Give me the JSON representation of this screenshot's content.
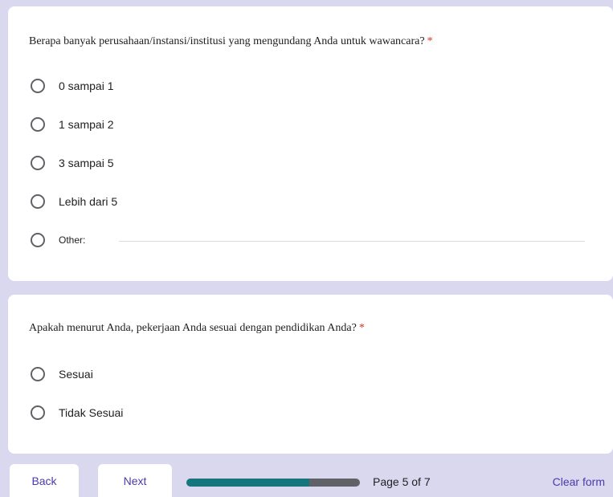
{
  "questions": [
    {
      "text": "Berapa banyak perusahaan/instansi/institusi yang mengundang Anda untuk wawancara?",
      "required_mark": "*",
      "options": [
        "0 sampai 1",
        "1 sampai 2",
        "3 sampai 5",
        "Lebih dari 5"
      ],
      "other_label": "Other:",
      "other_value": ""
    },
    {
      "text": "Apakah menurut Anda, pekerjaan Anda sesuai dengan pendidikan Anda?",
      "required_mark": "*",
      "options": [
        "Sesuai",
        "Tidak Sesuai"
      ]
    }
  ],
  "nav": {
    "back_label": "Back",
    "next_label": "Next",
    "progress_fraction": 0.71,
    "page_text": "Page 5 of 7",
    "clear_label": "Clear form"
  },
  "colors": {
    "background": "#d9d8ee",
    "accent": "#4c3aa8",
    "progress_fill": "#16767e",
    "progress_track": "#5f6368",
    "required": "#d93025"
  }
}
